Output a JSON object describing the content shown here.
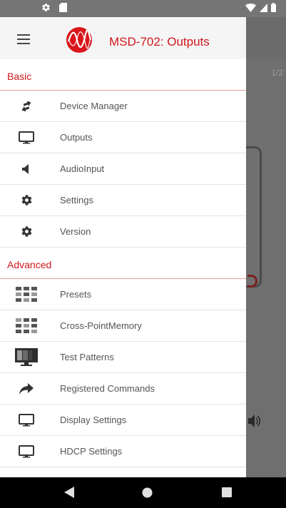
{
  "status_bar": {
    "icons": [
      "settings-icon",
      "sd-card-icon",
      "wifi-icon",
      "signal-icon",
      "battery-icon"
    ]
  },
  "app": {
    "title": "MSD-702: Outputs",
    "background_page_indicator": "1/2"
  },
  "drawer": {
    "sections": [
      {
        "header": "Basic",
        "items": [
          {
            "label": "Device Manager",
            "icon": "swap-arrows-icon"
          },
          {
            "label": "Outputs",
            "icon": "monitor-icon"
          },
          {
            "label": "AudioInput",
            "icon": "speaker-icon"
          },
          {
            "label": "Settings",
            "icon": "gear-icon"
          },
          {
            "label": "Version",
            "icon": "gear-icon"
          }
        ]
      },
      {
        "header": "Advanced",
        "items": [
          {
            "label": "Presets",
            "icon": "grid-icon"
          },
          {
            "label": "Cross-PointMemory",
            "icon": "grid-icon"
          },
          {
            "label": "Test Patterns",
            "icon": "test-pattern-icon"
          },
          {
            "label": "Registered Commands",
            "icon": "forward-arrow-icon"
          },
          {
            "label": "Display Settings",
            "icon": "monitor-icon"
          },
          {
            "label": "HDCP Settings",
            "icon": "monitor-icon"
          }
        ]
      }
    ]
  },
  "nav_bar": {
    "buttons": [
      "back-button",
      "home-button",
      "recents-button"
    ]
  },
  "colors": {
    "accent": "#d0161b",
    "status_bar": "#757575",
    "scrim": "#6b6b6b"
  }
}
